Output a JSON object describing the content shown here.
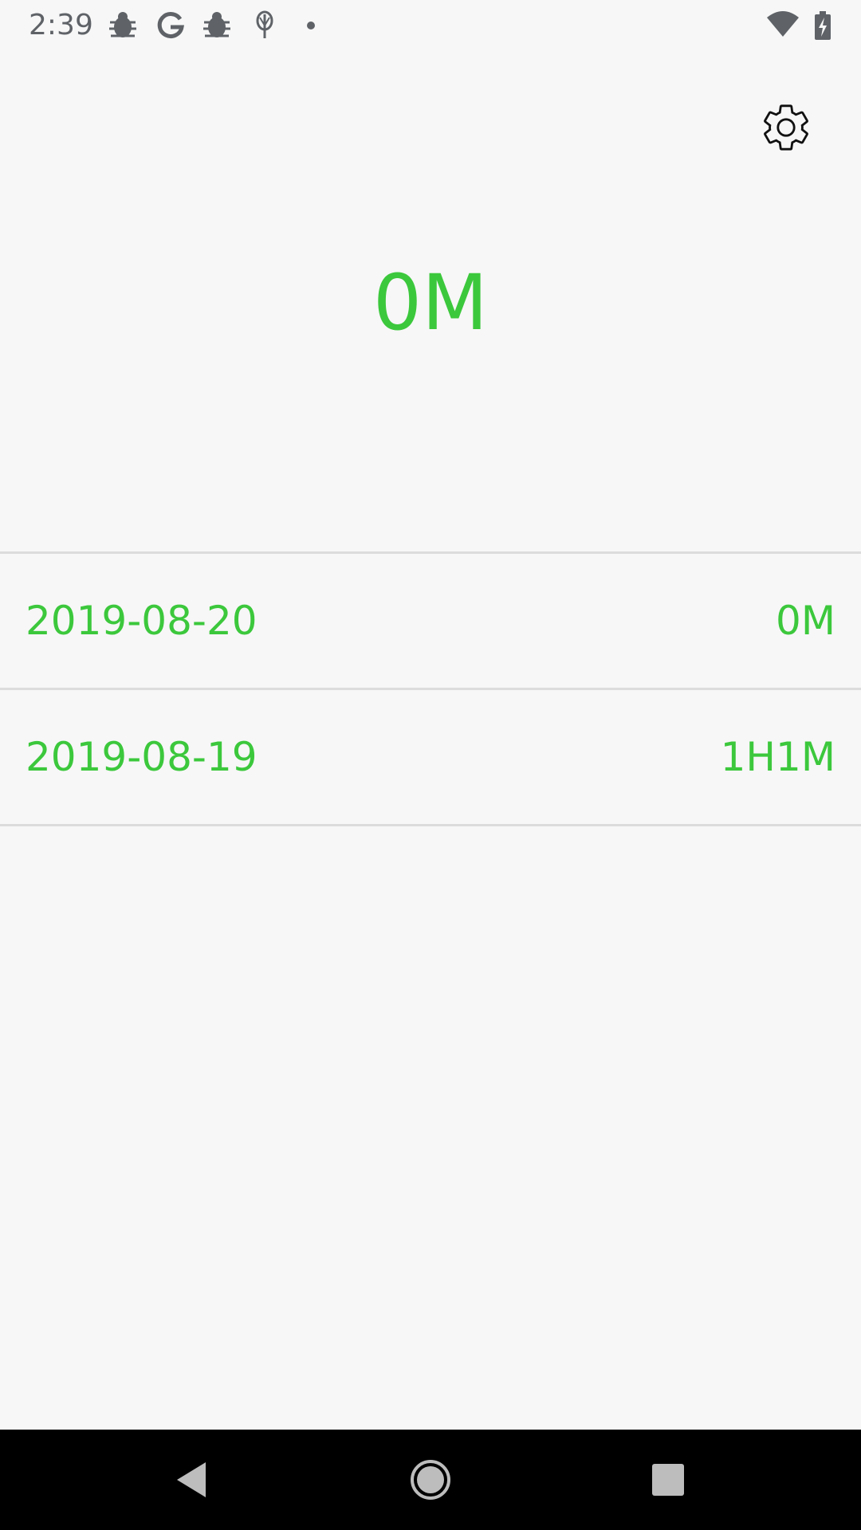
{
  "status_bar": {
    "time": "2:39",
    "icons": [
      "bug-icon",
      "google-icon",
      "bug-icon",
      "flower-icon",
      "dot-icon",
      "wifi-icon",
      "battery-charging-icon"
    ],
    "icon_color": "#5f6368"
  },
  "header": {
    "settings_icon": "gear-icon"
  },
  "summary": {
    "total": "0M",
    "accent_color": "#3cc83c"
  },
  "history": [
    {
      "date": "2019-08-20",
      "duration": "0M"
    },
    {
      "date": "2019-08-19",
      "duration": "1H1M"
    }
  ],
  "nav_bar": {
    "buttons": [
      "back-icon",
      "home-icon",
      "recents-icon"
    ]
  }
}
